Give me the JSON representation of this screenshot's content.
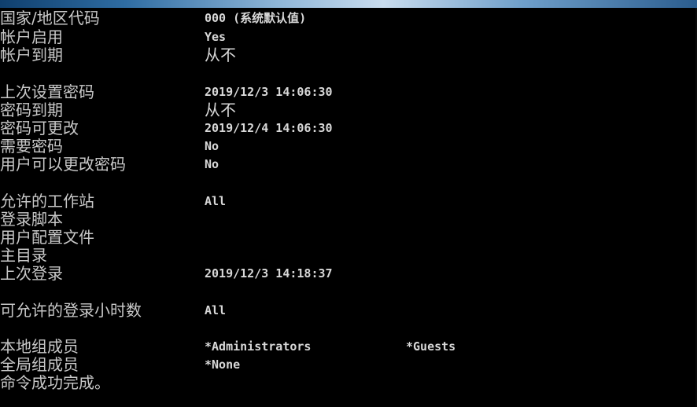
{
  "console": {
    "rows": [
      {
        "label": "国家/地区代码",
        "value": "000 (系统默认值)"
      },
      {
        "label": "帐户启用",
        "value": "Yes"
      },
      {
        "label": "帐户到期",
        "value": "从不"
      },
      {
        "label": "上次设置密码",
        "value": "2019/12/3 14:06:30"
      },
      {
        "label": "密码到期",
        "value": "从不"
      },
      {
        "label": "密码可更改",
        "value": "2019/12/4 14:06:30"
      },
      {
        "label": "需要密码",
        "value": "No"
      },
      {
        "label": "用户可以更改密码",
        "value": "No"
      },
      {
        "label": "允许的工作站",
        "value": "All"
      },
      {
        "label": "登录脚本",
        "value": ""
      },
      {
        "label": "用户配置文件",
        "value": ""
      },
      {
        "label": "主目录",
        "value": ""
      },
      {
        "label": "上次登录",
        "value": "2019/12/3 14:18:37"
      },
      {
        "label": "可允许的登录小时数",
        "value": "All"
      },
      {
        "label": "本地组成员",
        "value": "*Administrators",
        "value2": "*Guests"
      },
      {
        "label": "全局组成员",
        "value": "*None"
      },
      {
        "label": "命令成功完成。",
        "value": ""
      }
    ]
  }
}
